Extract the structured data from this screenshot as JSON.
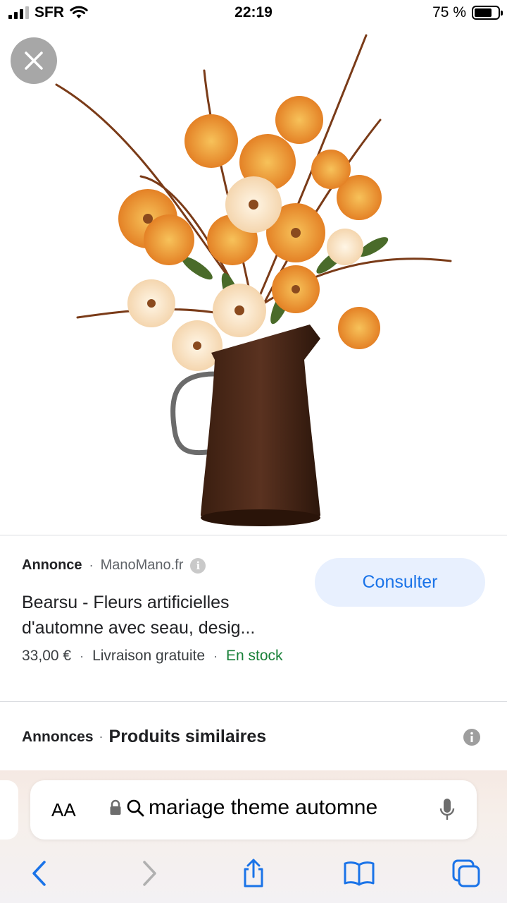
{
  "status_bar": {
    "carrier": "SFR",
    "time": "22:19",
    "battery": "75 %",
    "battery_level": 0.75
  },
  "icons": {
    "close": "close-icon",
    "info": "info-icon",
    "lock": "lock-icon",
    "search": "search-icon",
    "mic": "microphone-icon",
    "back": "chevron-left-icon",
    "forward": "chevron-right-icon",
    "share": "share-icon",
    "bookmarks": "book-icon",
    "tabs": "tabs-icon"
  },
  "ad": {
    "tag": "Annonce",
    "source": "ManoMano.fr",
    "title_line1": "Bearsu - Fleurs artificielles",
    "title_line2": "d'automne avec seau, desig...",
    "price": "33,00 €",
    "shipping": "Livraison gratuite",
    "stock": "En stock",
    "cta": "Consulter"
  },
  "similar": {
    "tag": "Annonces",
    "title": "Produits similaires"
  },
  "browser": {
    "text_size_label": "AA",
    "query": "mariage theme automne"
  },
  "colors": {
    "link_blue": "#1a73e8",
    "stock_green": "#188038",
    "button_bg": "#e8f0fe",
    "vase_brown": "#4a2818"
  }
}
